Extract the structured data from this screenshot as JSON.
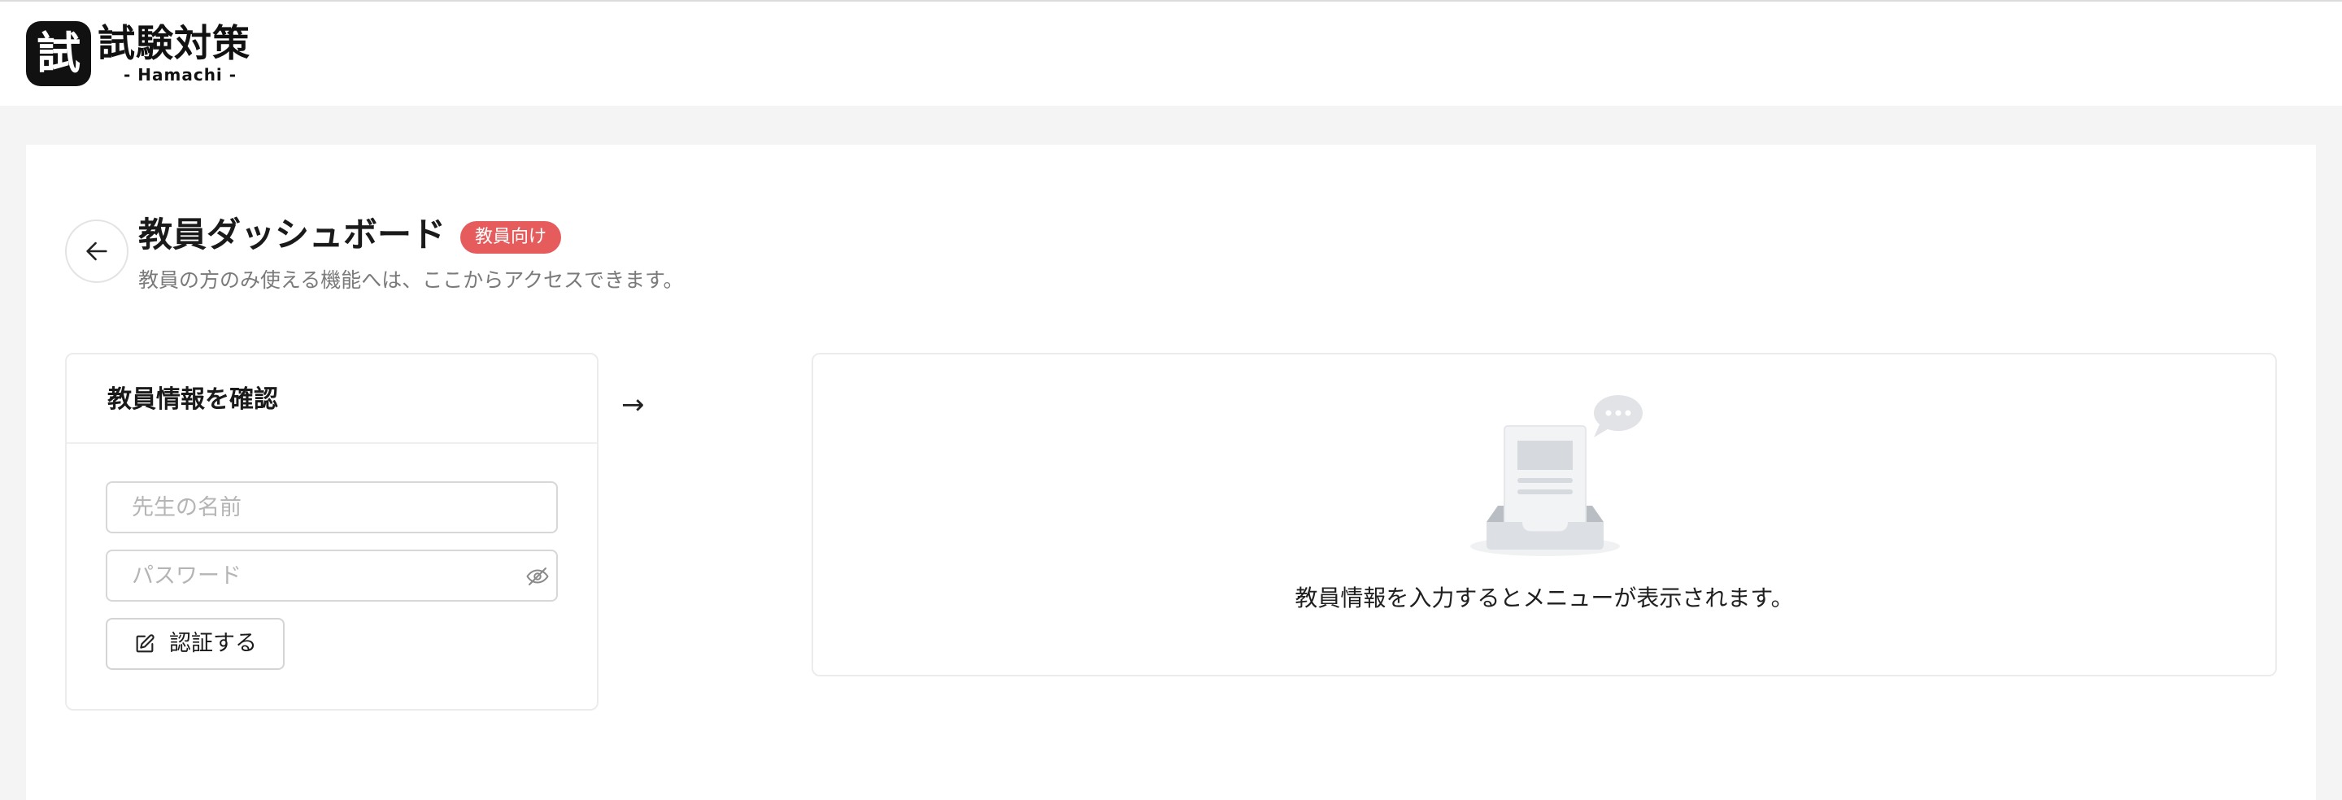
{
  "header": {
    "logo_mark": "試",
    "logo_title": "試験対策",
    "logo_sub": "- Hamachi -"
  },
  "page": {
    "title": "教員ダッシュボード",
    "badge": "教員向け",
    "subtitle": "教員の方のみ使える機能へは、ここからアクセスできます。"
  },
  "auth_card": {
    "title": "教員情報を確認",
    "name_placeholder": "先生の名前",
    "name_value": "",
    "password_placeholder": "パスワード",
    "password_value": "",
    "submit_label": "認証する"
  },
  "flow_arrow": "→",
  "result_card": {
    "empty_message": "教員情報を入力するとメニューが表示されます。"
  },
  "icons": {
    "back": "arrow-left-icon",
    "password_toggle": "eye-off-icon",
    "submit": "edit-icon",
    "empty": "inbox-empty-icon"
  },
  "colors": {
    "badge": "#e65b5b",
    "page_bg": "#f4f4f4"
  }
}
